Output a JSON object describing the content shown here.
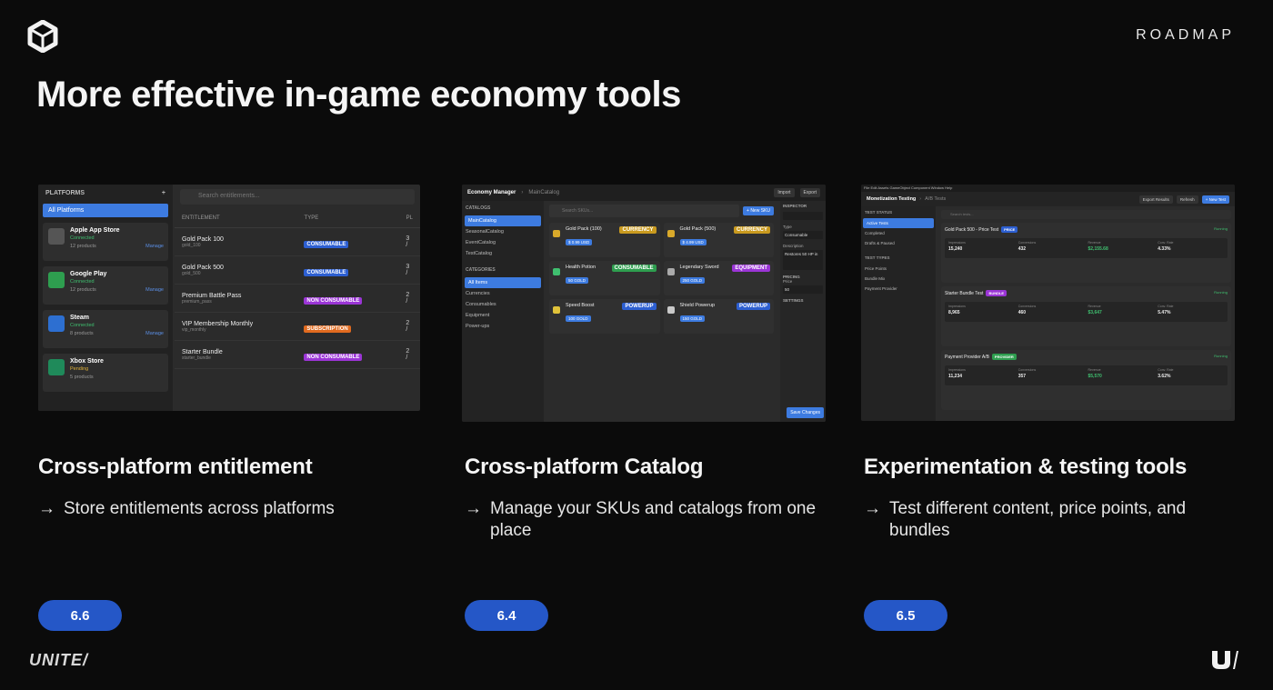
{
  "header": {
    "roadmap": "ROADMAP",
    "title": "More effective in-game economy tools"
  },
  "columns": [
    {
      "title": "Cross-platform entitlement",
      "bullet": "Store entitlements across platforms",
      "version": "6.6"
    },
    {
      "title": "Cross-platform Catalog",
      "bullet": "Manage your SKUs and catalogs from one place",
      "version": "6.4"
    },
    {
      "title": "Experimentation & testing tools",
      "bullet": "Test different content, price points, and bundles",
      "version": "6.5"
    }
  ],
  "footer": {
    "brand": "UNITE/"
  },
  "shot1": {
    "sidebar_title": "PLATFORMS",
    "all": "All Platforms",
    "search_placeholder": "Search entitlements...",
    "col_entitlement": "ENTITLEMENT",
    "col_type": "TYPE",
    "col_platform": "PL",
    "platforms": [
      {
        "name": "Apple App Store",
        "status": "Connected",
        "products": "12 products",
        "manage": "Manage",
        "color": "#555555",
        "status_color": "#3fbf6f"
      },
      {
        "name": "Google Play",
        "status": "Connected",
        "products": "12 products",
        "manage": "Manage",
        "color": "#2e9e4f",
        "status_color": "#3fbf6f"
      },
      {
        "name": "Steam",
        "status": "Connected",
        "products": "8 products",
        "manage": "Manage",
        "color": "#2d6fd1",
        "status_color": "#3fbf6f"
      },
      {
        "name": "Xbox Store",
        "status": "Pending",
        "products": "5 products",
        "manage": "",
        "color": "#1f8a5a",
        "status_color": "#e0b23a"
      }
    ],
    "rows": [
      {
        "name": "Gold Pack 100",
        "id": "gold_100",
        "type": "CONSUMABLE",
        "color": "#2d5fd1",
        "plat": "3 /"
      },
      {
        "name": "Gold Pack 500",
        "id": "gold_500",
        "type": "CONSUMABLE",
        "color": "#2d5fd1",
        "plat": "3 /"
      },
      {
        "name": "Premium Battle Pass",
        "id": "premium_pass",
        "type": "NON CONSUMABLE",
        "color": "#9b35d6",
        "plat": "2 /"
      },
      {
        "name": "VIP Membership Monthly",
        "id": "vip_monthly",
        "type": "SUBSCRIPTION",
        "color": "#e06a1f",
        "plat": "2 /"
      },
      {
        "name": "Starter Bundle",
        "id": "starter_bundle",
        "type": "NON CONSUMABLE",
        "color": "#9b35d6",
        "plat": "2 /"
      }
    ]
  },
  "shot2": {
    "app": "Economy Manager",
    "crumb": "MainCatalog",
    "import": "Import",
    "export": "Export",
    "catalogs_h": "CATALOGS",
    "catalogs": [
      "MainCatalog",
      "SeasonalCatalog",
      "EventCatalog",
      "TestCatalog"
    ],
    "categories_h": "CATEGORIES",
    "categories": [
      "All Items",
      "Currencies",
      "Consumables",
      "Equipment",
      "Power-ups"
    ],
    "search_placeholder": "Search SKUs...",
    "new_sku": "+ New SKU",
    "cards": [
      {
        "name": "Gold Pack (100)",
        "tag": "CURRENCY",
        "tag_color": "#c99a1f",
        "price": "$ 0.99 USD",
        "icon_color": "#d9a92a"
      },
      {
        "name": "Gold Pack (500)",
        "tag": "CURRENCY",
        "tag_color": "#c99a1f",
        "price": "$ 4.99 USD",
        "icon_color": "#d9a92a"
      },
      {
        "name": "Health Potion",
        "tag": "CONSUMABLE",
        "tag_color": "#2e9e4f",
        "price": "50 GOLD",
        "icon_color": "#3fbf6f"
      },
      {
        "name": "Legendary Sword",
        "tag": "EQUIPMENT",
        "tag_color": "#9b35d6",
        "price": "250 GOLD",
        "icon_color": "#aaaaaa"
      },
      {
        "name": "Speed Boost",
        "tag": "POWERUP",
        "tag_color": "#2d5fd1",
        "price": "100 GOLD",
        "icon_color": "#e0c23a"
      },
      {
        "name": "Shield Powerup",
        "tag": "POWERUP",
        "tag_color": "#2d5fd1",
        "price": "150 GOLD",
        "icon_color": "#c9c9c9"
      }
    ],
    "inspector_h": "INSPECTOR",
    "type_label": "Type",
    "type_value": "Consumable",
    "desc_label": "Description",
    "desc_value": "Restores 50 HP in",
    "pricing_h": "PRICING",
    "price_label": "Price",
    "price_value": "50",
    "settings_h": "SETTINGS",
    "save": "Save Changes"
  },
  "shot3": {
    "menu": "File   Edit   Assets   GameObject   Component   Window   Help",
    "app": "Monetization Testing",
    "crumb": "A/B Tests",
    "export": "Export Results",
    "refresh": "Refresh",
    "new_test": "+ New Test",
    "status_h": "TEST STATUS",
    "statuses": [
      "Active Tests",
      "Completed",
      "Drafts & Paused"
    ],
    "types_h": "TEST TYPES",
    "types": [
      "Price Points",
      "Bundle Mix",
      "Payment Provider"
    ],
    "search_placeholder": "Search tests...",
    "tests": [
      {
        "name": "Gold Pack 500 - Price Test",
        "tag": "PRICE",
        "tag_color": "#2d5fd1",
        "status": "Running",
        "impressions": "15,240",
        "conversions": "432",
        "revenue": "$2,155.68",
        "rate": "4.33%"
      },
      {
        "name": "Starter Bundle Test",
        "tag": "BUNDLE",
        "tag_color": "#9b35d6",
        "status": "Running",
        "impressions": "8,965",
        "conversions": "460",
        "revenue": "$3,647",
        "rate": "5.47%"
      },
      {
        "name": "Payment Provider A/B",
        "tag": "PROVIDER",
        "tag_color": "#2e9e4f",
        "status": "Running",
        "impressions": "11,234",
        "conversions": "357",
        "revenue": "$5,570",
        "rate": "3.62%"
      }
    ],
    "stat_labels": [
      "Impressions",
      "Conversions",
      "Revenue",
      "Conv. Rate"
    ]
  }
}
